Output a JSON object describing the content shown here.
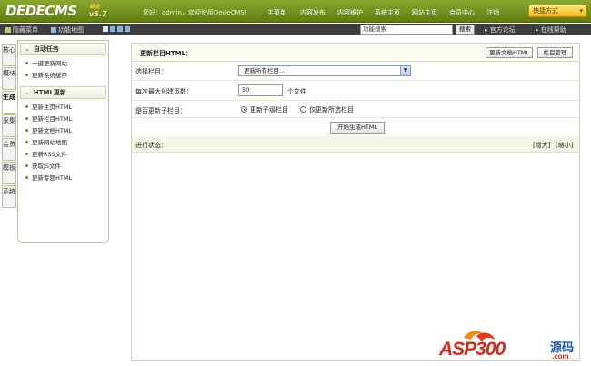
{
  "header": {
    "logo": "DEDECMS",
    "logo_badge": "商业",
    "version": "v5.7",
    "welcome": "您好：admin，欢迎使用DedeCMS！",
    "nav": [
      "主菜单",
      "内容发布",
      "内容维护",
      "系统主页",
      "网站主页",
      "会员中心",
      "注销"
    ],
    "quick_menu": "快捷方式",
    "quick_arrow": "▾"
  },
  "subbar": {
    "hide_menu": "隐藏菜单",
    "site_map": "功能地图",
    "search_placeholder": "功能搜索",
    "search_button": "搜索",
    "forum_link": "官方论坛",
    "help_link": "在线帮助"
  },
  "vtabs": [
    "核心",
    "模块",
    "生成",
    "采集",
    "会员",
    "模板",
    "系统"
  ],
  "sidebar": {
    "sections": [
      {
        "title": "自动任务",
        "items": [
          "一键更新网站",
          "更新系统缓存"
        ]
      },
      {
        "title": "HTML更新",
        "items": [
          "更新主页HTML",
          "更新栏目HTML",
          "更新文档HTML",
          "更新网站地图",
          "更新RSS文件",
          "获取JS文件",
          "更新专题HTML"
        ]
      }
    ]
  },
  "main": {
    "title": "更新栏目HTML：",
    "btn_update_docs": "更新文档HTML",
    "btn_column_manage": "栏目管理",
    "select_label": "选择栏目：",
    "select_value": "更新所有栏目...",
    "pages_label": "每次最大创建页数：",
    "pages_value": "50",
    "pages_unit": "个文件",
    "subcol_label": "是否更新子栏目：",
    "radio_update_sub": "更新子级栏目",
    "radio_only_selected": "仅更新所选栏目",
    "generate_button": "开始生成HTML",
    "progress_label": "进行状态：",
    "enlarge": "[增大]",
    "shrink": "[缩小]"
  },
  "watermark": {
    "text": "ASP300",
    "suffix": "源码",
    "domain": ".com"
  }
}
